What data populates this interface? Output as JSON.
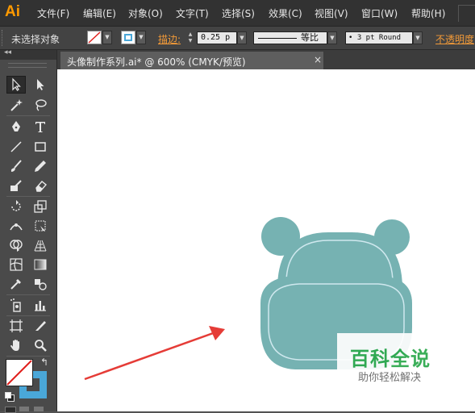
{
  "app": {
    "logo": "Ai"
  },
  "menu": {
    "items": [
      "文件(F)",
      "编辑(E)",
      "对象(O)",
      "文字(T)",
      "选择(S)",
      "效果(C)",
      "视图(V)",
      "窗口(W)",
      "帮助(H)"
    ]
  },
  "control_bar": {
    "status": "未选择对象",
    "stroke_label": "描边:",
    "stroke_weight": "0.25 p",
    "profile_label": "等比",
    "brush": "• 3 pt Round",
    "opacity_label": "不透明度"
  },
  "document": {
    "tab_title": "头像制作系列.ai* @ 600% (CMYK/预览)",
    "close_glyph": "×"
  },
  "tools": {
    "colors_note": "",
    "swap_glyph": "↰"
  },
  "artwork": {
    "fill_color": "#76b2b2",
    "stroke_color": "#cfe8ee",
    "arrow_color": "#e53c37"
  },
  "watermark": {
    "title": "百科全说",
    "subtitle": "助你轻松解决"
  }
}
